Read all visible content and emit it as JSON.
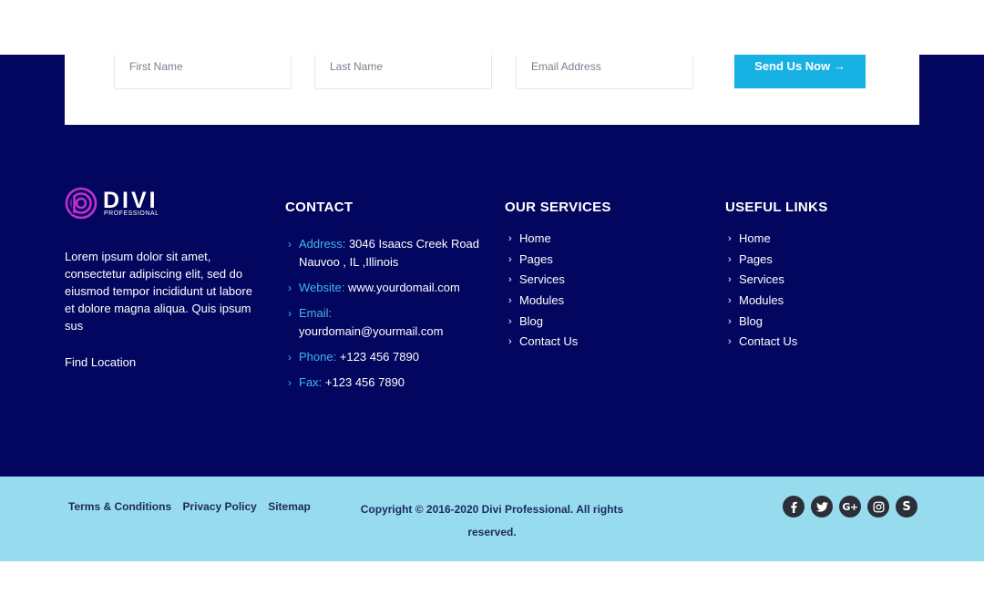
{
  "form": {
    "first_name_placeholder": "First Name",
    "last_name_placeholder": "Last Name",
    "email_placeholder": "Email Address",
    "send_label": "Send Us Now →"
  },
  "brand": {
    "name": "DIVI",
    "tagline": "PROFESSIONAL",
    "accent_color": "#c42fd0"
  },
  "about": {
    "text": "Lorem ipsum dolor sit amet, consectetur adipiscing elit, sed do eiusmod tempor incididunt ut labore et dolore magna aliqua. Quis ipsum sus",
    "find_location": "Find Location"
  },
  "contact": {
    "title": "CONTACT",
    "address_label": "Address:",
    "address_line1": "3046 Isaacs Creek Road",
    "address_line2": "Nauvoo , IL ,Illinois",
    "website_label": "Website:",
    "website": "www.yourdomail.com",
    "email_label": "Email:",
    "email": "yourdomain@yourmail.com",
    "phone_label": "Phone:",
    "phone": "+123 456 7890",
    "fax_label": "Fax:",
    "fax": "+123 456 7890"
  },
  "services": {
    "title": "OUR SERVICES",
    "items": [
      "Home",
      "Pages",
      "Services",
      "Modules",
      "Blog",
      "Contact Us"
    ]
  },
  "useful_links": {
    "title": "USEFUL LINKS",
    "items": [
      "Home",
      "Pages",
      "Services",
      "Modules",
      "Blog",
      "Contact Us"
    ]
  },
  "bottom": {
    "terms": "Terms & Conditions",
    "privacy": "Privacy Policy",
    "sitemap": "Sitemap",
    "copyright": "Copyright © 2016-2020 Divi Professional. All rights reserved."
  },
  "socials": [
    "facebook-icon",
    "twitter-icon",
    "google-plus-icon",
    "instagram-icon",
    "skype-icon"
  ],
  "colors": {
    "footer_bg": "#03065f",
    "bottom_bar_bg": "#97dcee",
    "button_bg": "#17b2e3",
    "link_accent": "#42b6e8"
  }
}
